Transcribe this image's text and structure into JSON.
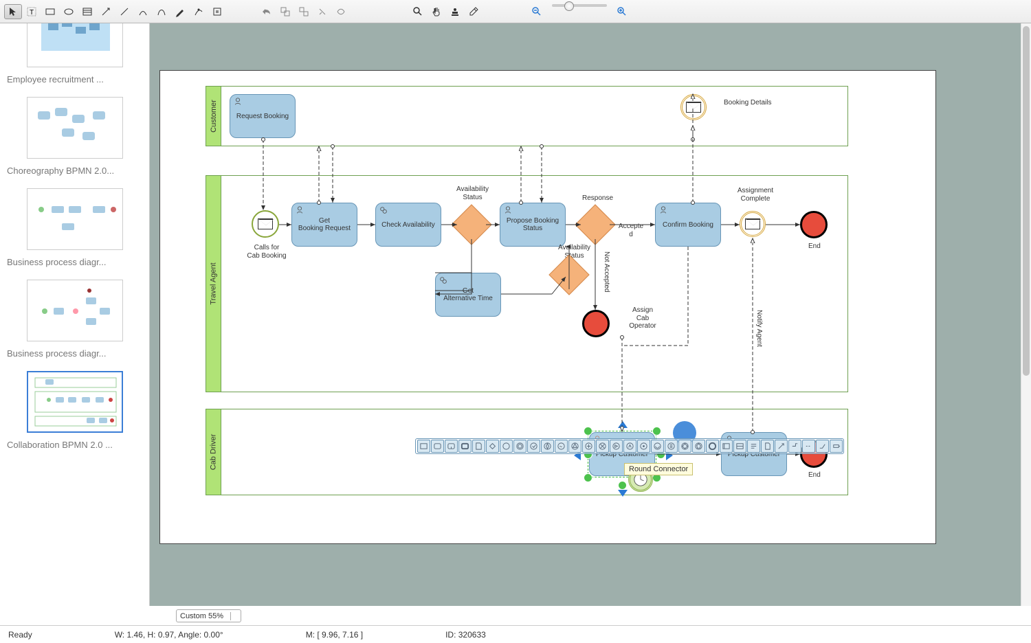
{
  "toolbar": {
    "tools": [
      "select",
      "text",
      "rect",
      "ellipse",
      "table",
      "arrow",
      "line",
      "curve",
      "bezier",
      "pen",
      "reshape",
      "crop"
    ],
    "edit": [
      "undo",
      "group",
      "ungroup",
      "split",
      "intersect"
    ],
    "view": [
      "zoom",
      "pan",
      "stamp",
      "eyedrop"
    ],
    "zoom": [
      "zoom-out",
      "zoom-in"
    ]
  },
  "sidebar": [
    {
      "label": "Employee recruitment ..."
    },
    {
      "label": "Choreography BPMN 2.0..."
    },
    {
      "label": "Business process diagr..."
    },
    {
      "label": "Business process diagr..."
    },
    {
      "label": "Collaboration BPMN 2.0 ...",
      "selected": true
    }
  ],
  "lanes": {
    "customer": "Customer",
    "agent": "Travel Agent",
    "driver": "Cab Driver"
  },
  "tasks": {
    "request": "Request Booking",
    "get": "Get\nBooking Request",
    "check": "Check Availability",
    "propose": "Propose Booking Status",
    "confirm": "Confirm Booking",
    "alt": "Get\nAlternative Time",
    "pickup1": "Pickup Customer",
    "pickup2": "Pickup Customer"
  },
  "labels": {
    "calls": "Calls for\nCab Booking",
    "avail_status": "Availability\nStatus",
    "avail_status2": "Availability\nStatus",
    "response": "Response",
    "accepted": "Accepte\nd",
    "not_accepted": "Not Accepted",
    "assign": "Assign\nCab\nOperator",
    "assign_complete": "Assignment\nComplete",
    "notify": "Notify Agent",
    "booking_details": "Booking Details",
    "end1": "End",
    "end2": "End"
  },
  "tooltip": "Round Connector",
  "zoom_combo": "Custom 55%",
  "status": {
    "ready": "Ready",
    "dims": "W: 1.46,  H: 0.97,  Angle: 0.00°",
    "mouse": "M: [ 9.96, 7.16 ]",
    "id": "ID: 320633"
  }
}
